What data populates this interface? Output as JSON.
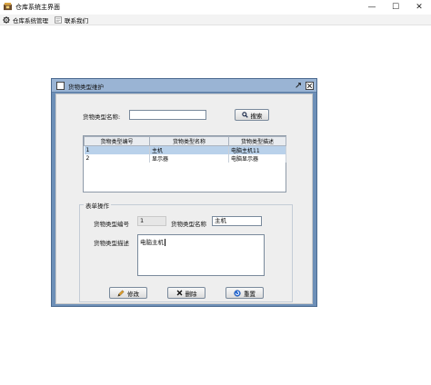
{
  "window": {
    "title": "仓库系统主界面",
    "controls": {
      "minimize": "—",
      "maximize": "☐",
      "close": "✕"
    }
  },
  "menubar": {
    "items": [
      {
        "label": "仓库系统管理",
        "icon": "gear-icon"
      },
      {
        "label": "联系我们",
        "icon": "contact-icon"
      }
    ]
  },
  "dialog": {
    "title": "货物类型维护",
    "search": {
      "label": "货物类型名称:",
      "value": "",
      "button": "搜索"
    },
    "table": {
      "columns": [
        "货物类型编号",
        "货物类型名称",
        "货物类型描述"
      ],
      "rows": [
        {
          "id": "1",
          "name": "主机",
          "desc": "电脑主机11",
          "selected": true
        },
        {
          "id": "2",
          "name": "显示器",
          "desc": "电脑显示器",
          "selected": false
        }
      ]
    },
    "form": {
      "legend": "表单操作",
      "id_label": "货物类型编号",
      "id_value": "1",
      "name_label": "货物类型名称",
      "name_value": "主机",
      "desc_label": "货物类型描述",
      "desc_value": "电脑主机"
    },
    "buttons": {
      "edit": "修改",
      "delete": "删除",
      "reset": "重置"
    }
  }
}
